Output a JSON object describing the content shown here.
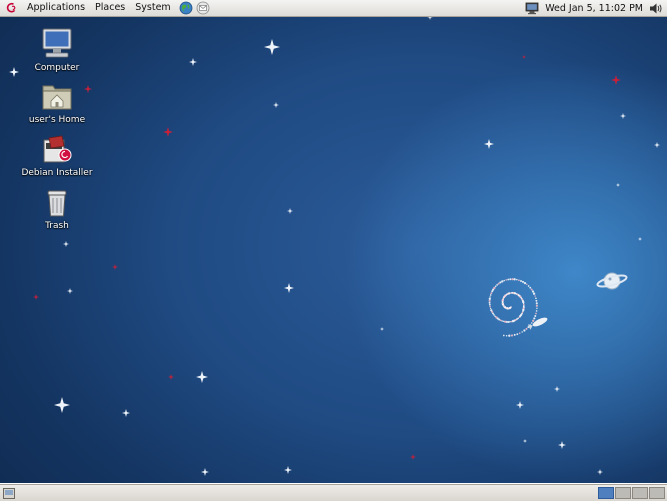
{
  "top_panel": {
    "menus": [
      "Applications",
      "Places",
      "System"
    ],
    "clock": "Wed Jan  5, 11:02 PM"
  },
  "icons": {
    "logo": "debian-swirl-icon",
    "web_browser": "web-browser-icon",
    "email": "email-client-icon",
    "network": "network-monitor-icon",
    "volume": "volume-icon"
  },
  "desktop": {
    "icons": [
      {
        "label": "Computer",
        "icon": "computer-icon"
      },
      {
        "label": "user's Home",
        "icon": "home-folder-icon"
      },
      {
        "label": "Debian Installer",
        "icon": "installer-icon"
      },
      {
        "label": "Trash",
        "icon": "trash-icon"
      }
    ]
  },
  "bottom_panel": {
    "workspaces": 4,
    "active_workspace": 1
  },
  "colors": {
    "desktop_blue": "#1f4a82",
    "panel": "#e6e4e0",
    "active_workspace": "#4f7fbf"
  }
}
